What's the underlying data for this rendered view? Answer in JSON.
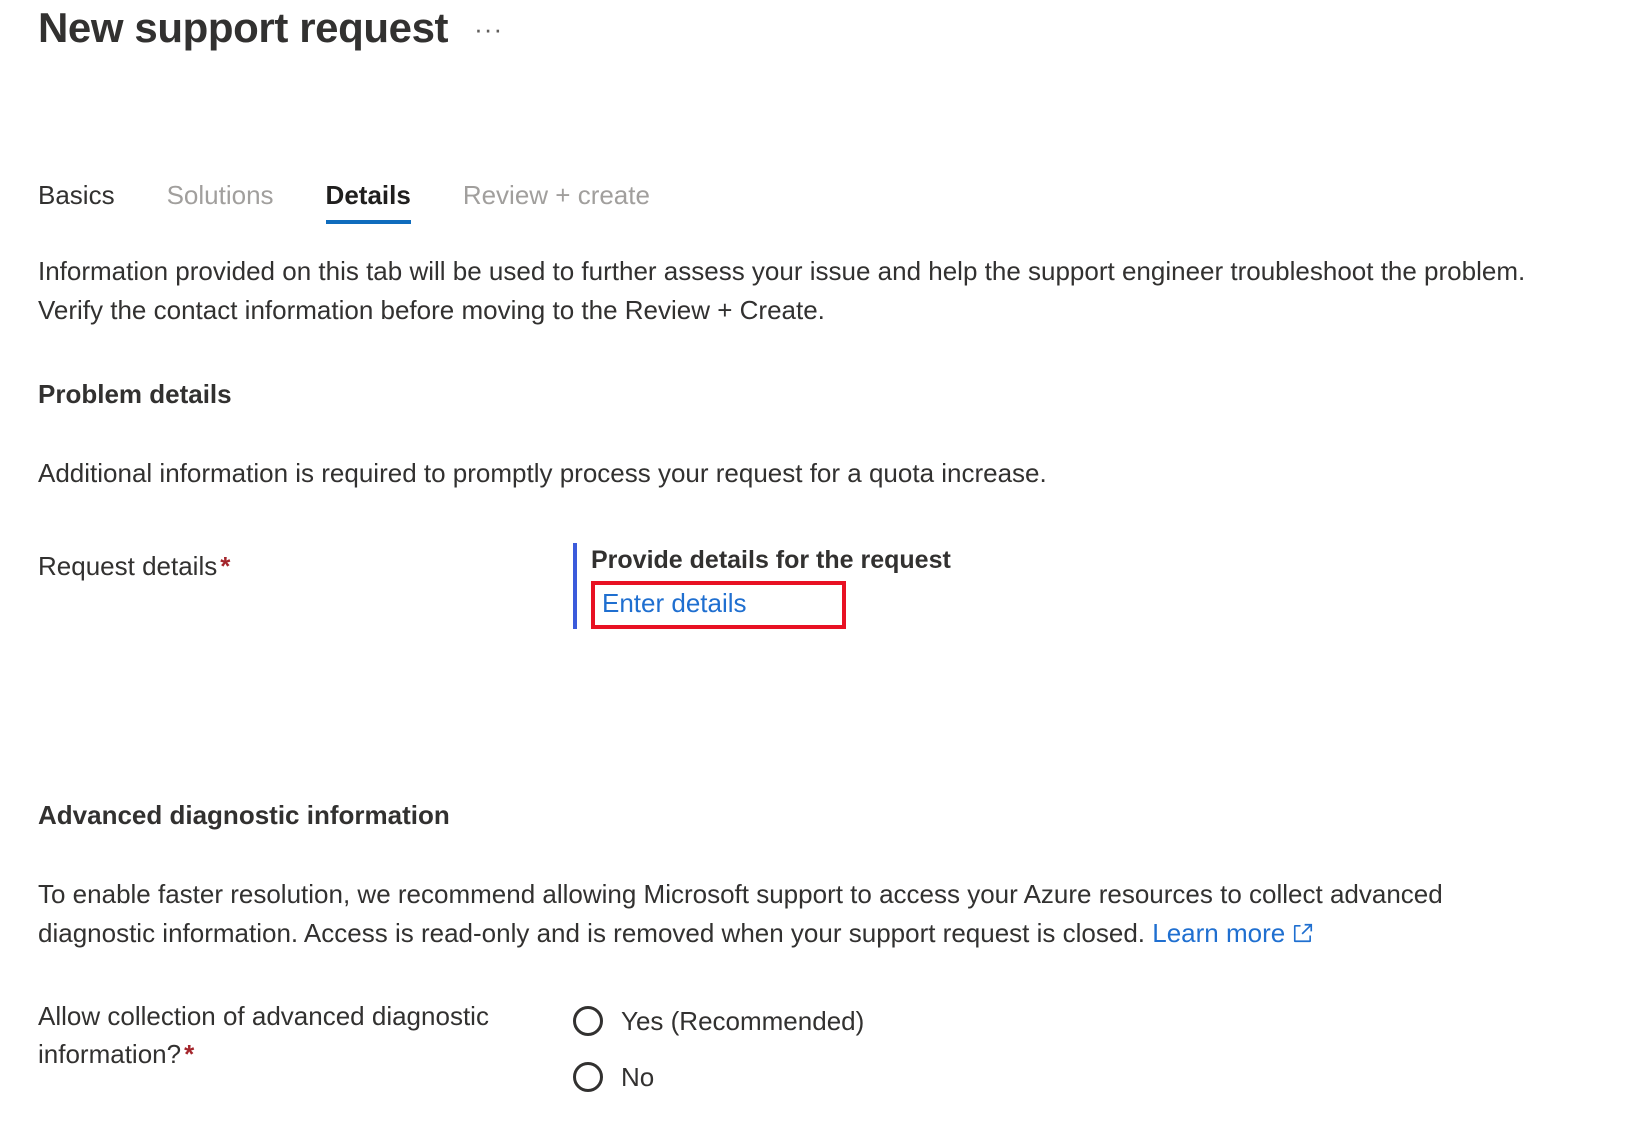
{
  "header": {
    "title": "New support request",
    "more_menu": "···"
  },
  "tabs": [
    {
      "label": "Basics",
      "state": "enabled"
    },
    {
      "label": "Solutions",
      "state": "disabled"
    },
    {
      "label": "Details",
      "state": "active"
    },
    {
      "label": "Review + create",
      "state": "disabled"
    }
  ],
  "intro": "Information provided on this tab will be used to further assess your issue and help the support engineer troubleshoot the problem. Verify the contact information before moving to the Review + Create.",
  "problem_details": {
    "heading": "Problem details",
    "description": "Additional information is required to promptly process your request for a quota increase.",
    "request_details": {
      "label": "Request details",
      "required_marker": "*",
      "control_title": "Provide details for the request",
      "link_text": "Enter details"
    }
  },
  "advanced_diagnostic": {
    "heading": "Advanced diagnostic information",
    "description_before_link": "To enable faster resolution, we recommend allowing Microsoft support to access your Azure resources to collect advanced diagnostic information. Access is read-only and is removed when your support request is closed.",
    "learn_more_label": "Learn more",
    "consent": {
      "label": "Allow collection of advanced diagnostic information?",
      "required_marker": "*",
      "options": [
        {
          "label": "Yes (Recommended)",
          "selected": false
        },
        {
          "label": "No",
          "selected": false
        }
      ]
    }
  },
  "colors": {
    "accent_blue": "#0f6cbd",
    "link_blue": "#1f6fd0",
    "required_red": "#a4262c",
    "highlight_red": "#e81123",
    "control_bar_blue": "#3b5bdb",
    "text_primary": "#323130",
    "text_disabled": "#a19f9d"
  }
}
